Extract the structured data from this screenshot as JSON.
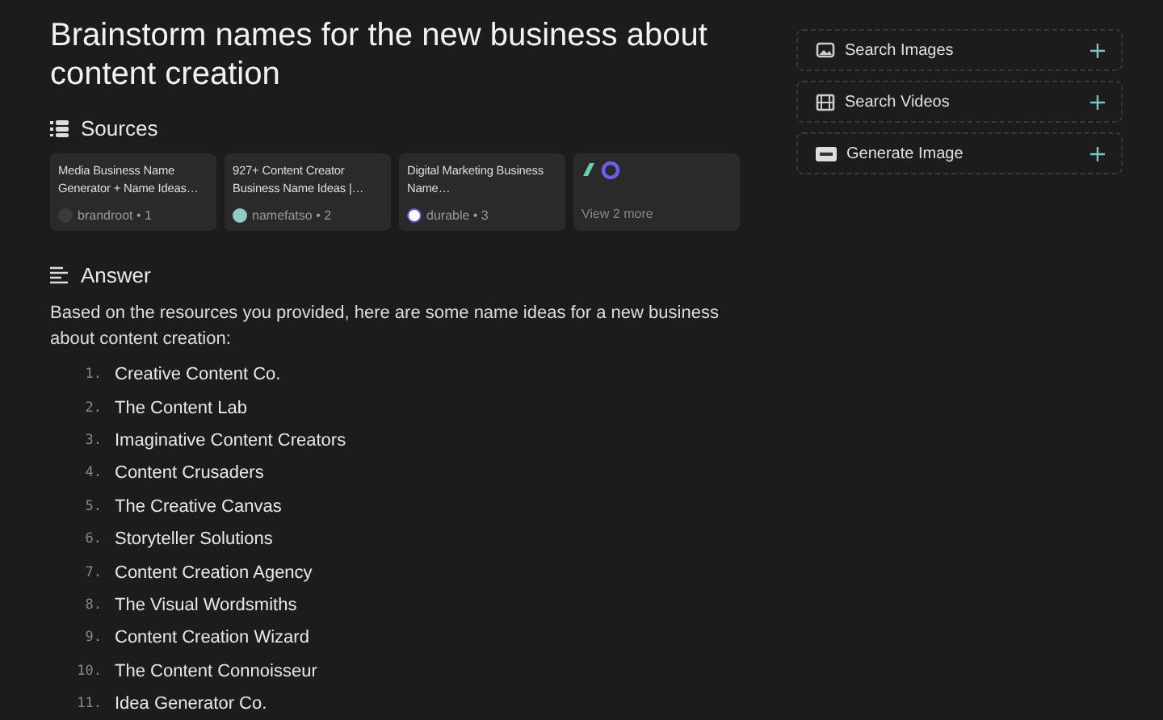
{
  "title": "Brainstorm names for the new business about content creation",
  "sources": {
    "heading": "Sources",
    "items": [
      {
        "kind": "source",
        "title": "Media Business Name Generator + Name Ideas…",
        "site": "brandroot • 1"
      },
      {
        "kind": "source",
        "title": "927+ Content Creator Business Name Ideas |…",
        "site": "namefatso • 2"
      },
      {
        "kind": "source",
        "title": "Digital Marketing Business Name…",
        "site": "durable • 3"
      },
      {
        "kind": "more",
        "label": "View 2 more"
      }
    ]
  },
  "answer": {
    "heading": "Answer",
    "intro": "Based on the resources you provided, here are some name ideas for a new business about content creation:",
    "items": [
      {
        "number": "1.",
        "text": "Creative Content Co."
      },
      {
        "number": "2.",
        "text": "The Content Lab"
      },
      {
        "number": "3.",
        "text": "Imaginative Content Creators"
      },
      {
        "number": "4.",
        "text": "Content Crusaders"
      },
      {
        "number": "5.",
        "text": "The Creative Canvas"
      },
      {
        "number": "6.",
        "text": "Storyteller Solutions"
      },
      {
        "number": "7.",
        "text": "Content Creation Agency"
      },
      {
        "number": "8.",
        "text": "The Visual Wordsmiths"
      },
      {
        "number": "9.",
        "text": "Content Creation Wizard"
      },
      {
        "number": "10.",
        "text": "The Content Connoisseur"
      },
      {
        "number": "11.",
        "text": "Idea Generator Co."
      }
    ]
  },
  "actions": [
    {
      "kind": "images",
      "label": "Search Images"
    },
    {
      "kind": "videos",
      "label": "Search Videos"
    },
    {
      "kind": "generate",
      "label": "Generate Image"
    }
  ]
}
